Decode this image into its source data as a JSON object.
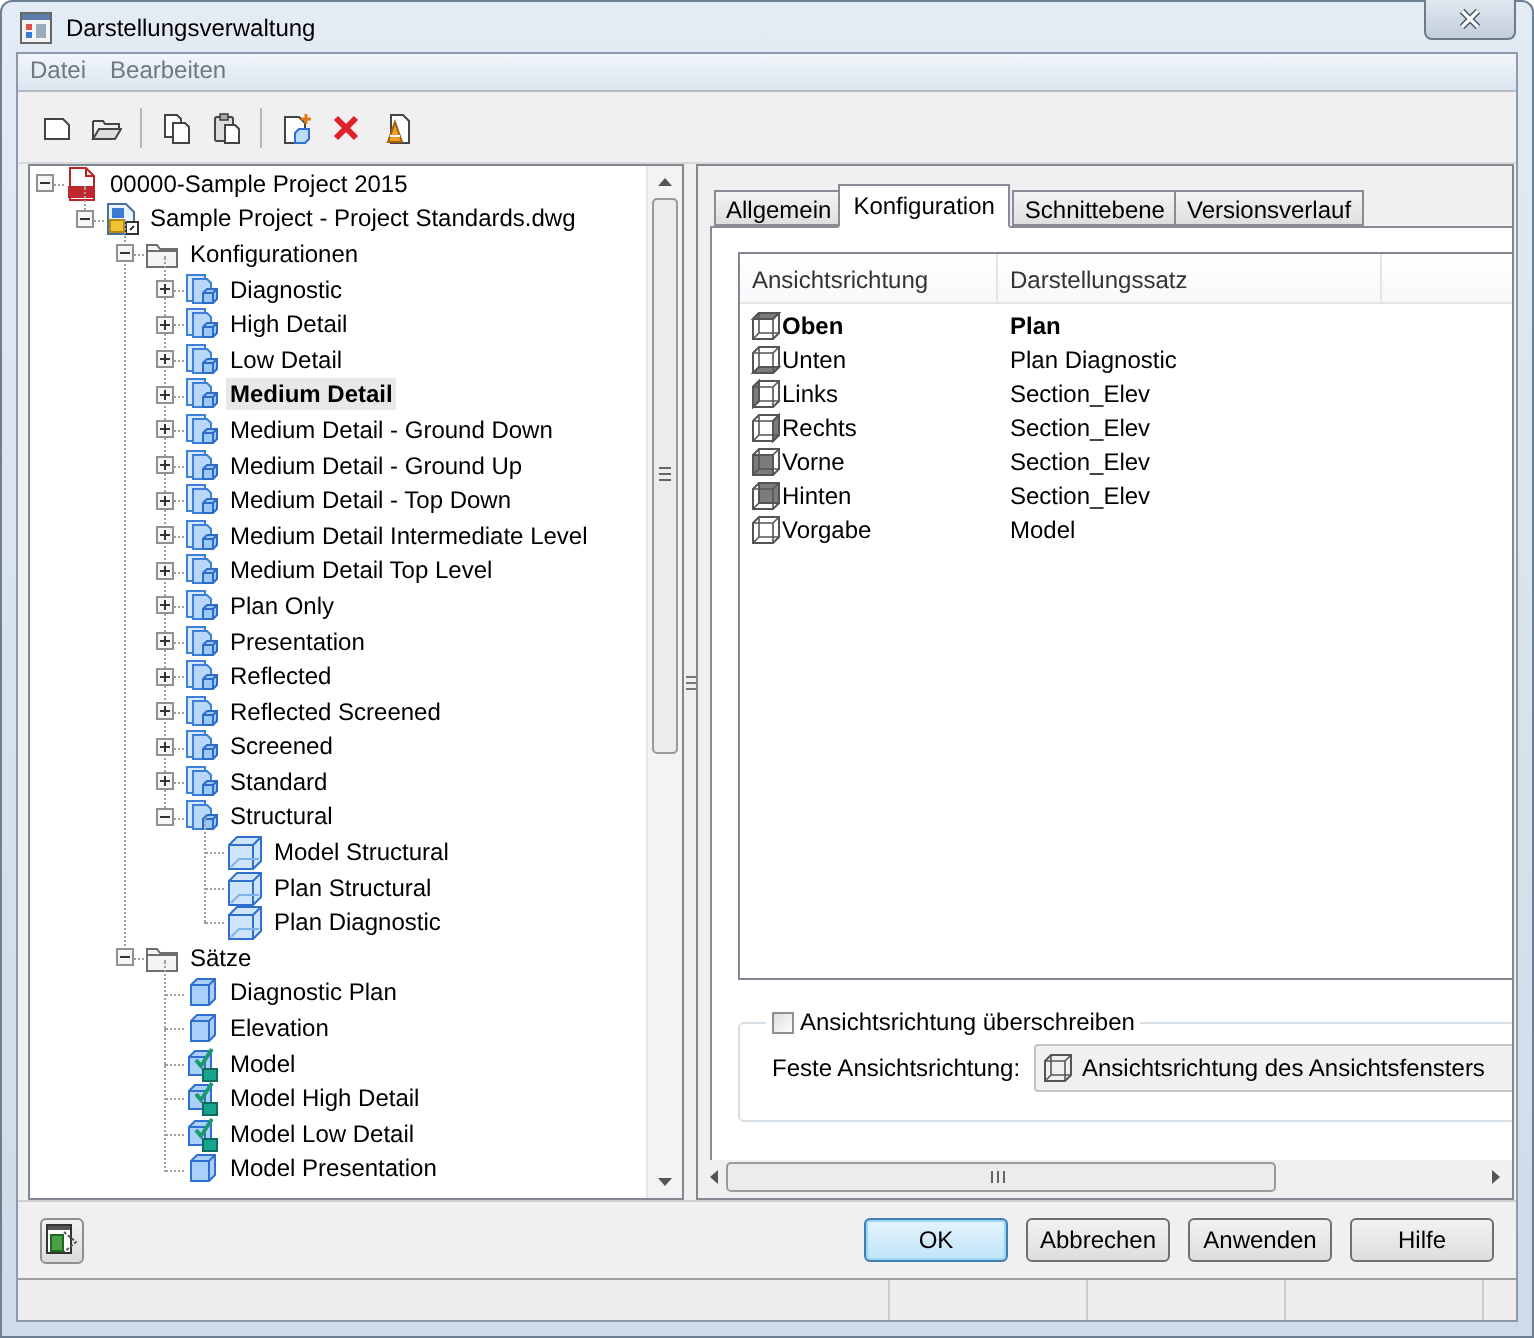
{
  "window": {
    "title": "Darstellungsverwaltung"
  },
  "menu": [
    {
      "label": "Datei"
    },
    {
      "label": "Bearbeiten"
    }
  ],
  "tree": [
    {
      "label": "00000-Sample Project 2015",
      "kind": "project",
      "selected": false,
      "expanded": true,
      "children": [
        {
          "label": "Sample Project - Project Standards.dwg",
          "kind": "drawing",
          "selected": false,
          "expanded": true,
          "children": [
            {
              "label": "Konfigurationen",
              "kind": "folder",
              "selected": false,
              "expanded": true,
              "children": [
                {
                  "label": "Diagnostic",
                  "kind": "config",
                  "selected": false,
                  "expanded": false
                },
                {
                  "label": "High Detail",
                  "kind": "config",
                  "selected": false,
                  "expanded": false
                },
                {
                  "label": "Low Detail",
                  "kind": "config",
                  "selected": false,
                  "expanded": false
                },
                {
                  "label": "Medium Detail",
                  "kind": "config",
                  "selected": true,
                  "expanded": false
                },
                {
                  "label": "Medium Detail - Ground Down",
                  "kind": "config",
                  "selected": false,
                  "expanded": false
                },
                {
                  "label": "Medium Detail - Ground Up",
                  "kind": "config",
                  "selected": false,
                  "expanded": false
                },
                {
                  "label": "Medium Detail - Top Down",
                  "kind": "config",
                  "selected": false,
                  "expanded": false
                },
                {
                  "label": "Medium Detail Intermediate Level",
                  "kind": "config",
                  "selected": false,
                  "expanded": false
                },
                {
                  "label": "Medium Detail Top Level",
                  "kind": "config",
                  "selected": false,
                  "expanded": false
                },
                {
                  "label": "Plan Only",
                  "kind": "config",
                  "selected": false,
                  "expanded": false
                },
                {
                  "label": "Presentation",
                  "kind": "config",
                  "selected": false,
                  "expanded": false
                },
                {
                  "label": "Reflected",
                  "kind": "config",
                  "selected": false,
                  "expanded": false
                },
                {
                  "label": "Reflected Screened",
                  "kind": "config",
                  "selected": false,
                  "expanded": false
                },
                {
                  "label": "Screened",
                  "kind": "config",
                  "selected": false,
                  "expanded": false
                },
                {
                  "label": "Standard",
                  "kind": "config",
                  "selected": false,
                  "expanded": false
                },
                {
                  "label": "Structural",
                  "kind": "config",
                  "selected": false,
                  "expanded": true,
                  "children": [
                    {
                      "label": "Model Structural",
                      "kind": "view-cube",
                      "selected": false
                    },
                    {
                      "label": "Plan Structural",
                      "kind": "view-cube",
                      "selected": false
                    },
                    {
                      "label": "Plan Diagnostic",
                      "kind": "view-cube",
                      "selected": false
                    }
                  ]
                }
              ]
            },
            {
              "label": "Sätze",
              "kind": "folder",
              "selected": false,
              "expanded": true,
              "children": [
                {
                  "label": "Diagnostic Plan",
                  "kind": "set",
                  "selected": false
                },
                {
                  "label": "Elevation",
                  "kind": "set",
                  "selected": false
                },
                {
                  "label": "Model",
                  "kind": "model-set",
                  "selected": false
                },
                {
                  "label": "Model High Detail",
                  "kind": "model-set",
                  "selected": false
                },
                {
                  "label": "Model Low Detail",
                  "kind": "model-set",
                  "selected": false
                },
                {
                  "label": "Model Presentation",
                  "kind": "set",
                  "selected": false
                }
              ]
            }
          ]
        }
      ]
    }
  ],
  "tabs": [
    {
      "label": "Allgemein",
      "selected": false
    },
    {
      "label": "Konfiguration",
      "selected": true
    },
    {
      "label": "Schnittebene",
      "selected": false
    },
    {
      "label": "Versionsverlauf",
      "selected": false
    }
  ],
  "view_table": {
    "columns": [
      "Ansichtsrichtung",
      "Darstellungssatz"
    ],
    "rows": [
      {
        "view": "Oben",
        "set": "Plan",
        "kind": "top",
        "current": true
      },
      {
        "view": "Unten",
        "set": "Plan Diagnostic",
        "kind": "bottom",
        "current": false
      },
      {
        "view": "Links",
        "set": "Section_Elev",
        "kind": "left",
        "current": false
      },
      {
        "view": "Rechts",
        "set": "Section_Elev",
        "kind": "right",
        "current": false
      },
      {
        "view": "Vorne",
        "set": "Section_Elev",
        "kind": "front",
        "current": false
      },
      {
        "view": "Hinten",
        "set": "Section_Elev",
        "kind": "back",
        "current": false
      },
      {
        "view": "Vorgabe",
        "set": "Model",
        "kind": "none",
        "current": false
      }
    ]
  },
  "override": {
    "label": "Ansichtsrichtung überschreiben",
    "checked": false
  },
  "fixed_view": {
    "label": "Feste Ansichtsrichtung:",
    "value": "Ansichtsrichtung des Ansichtsfensters",
    "disabled": true
  },
  "buttons": [
    {
      "label": "OK",
      "default": true
    },
    {
      "label": "Abbrechen",
      "default": false
    },
    {
      "label": "Anwenden",
      "default": false
    },
    {
      "label": "Hilfe",
      "default": false
    }
  ]
}
